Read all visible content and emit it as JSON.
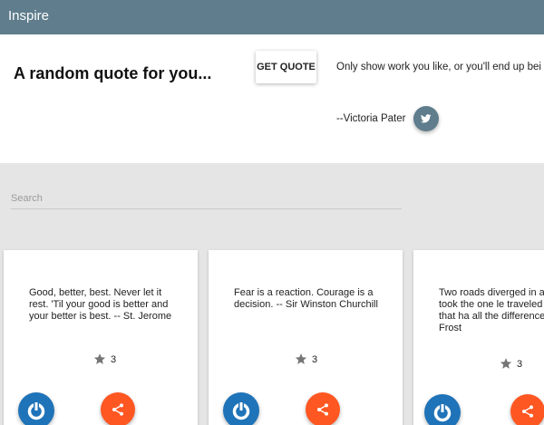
{
  "app": {
    "title": "Inspire",
    "bar_color": "#5f7d8c"
  },
  "hero": {
    "heading": "A random quote for you...",
    "get_quote_label": "GET QUOTE",
    "quote_text": "Only show work you like, or you'll end up bei",
    "quote_author": "--Victoria Pater",
    "tweet_icon": "twitter-icon"
  },
  "search": {
    "placeholder": "Search",
    "value": ""
  },
  "cards": [
    {
      "text": "Good, better, best. Never let it rest. 'Til your good is better and your better is best. -- St. Jerome",
      "rating": "3"
    },
    {
      "text": "Fear is a reaction. Courage is a decision. -- Sir Winston Churchill",
      "rating": "3"
    },
    {
      "text": "Two roads diverged in a and I - I took the one le traveled by, and that ha all the difference. -- Rob Frost",
      "rating": "3"
    }
  ],
  "icons": {
    "star": "star-icon",
    "power": "power-icon",
    "share": "share-icon"
  },
  "colors": {
    "power_button": "#1f73b8",
    "share_button": "#ff5722",
    "background": "#e5e5e5"
  }
}
